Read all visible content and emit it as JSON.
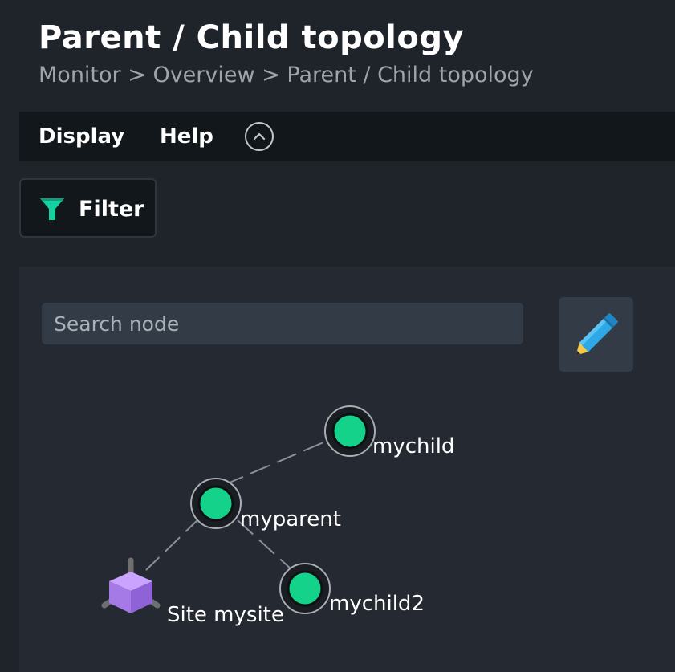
{
  "page": {
    "title": "Parent / Child topology",
    "breadcrumb": [
      "Monitor",
      "Overview",
      "Parent / Child topology"
    ],
    "breadcrumb_separator": ">"
  },
  "menu": {
    "display_label": "Display",
    "help_label": "Help",
    "collapse_icon": "chevron-up-icon"
  },
  "filter": {
    "label": "Filter",
    "icon": "funnel-icon",
    "icon_color": "#15d1a0"
  },
  "search": {
    "placeholder": "Search node",
    "value": ""
  },
  "edit": {
    "icon": "pencil-icon"
  },
  "topology": {
    "nodes": [
      {
        "id": "mychild",
        "label": "mychild",
        "type": "host",
        "status_color": "#15d28a"
      },
      {
        "id": "myparent",
        "label": "myparent",
        "type": "host",
        "status_color": "#15d28a"
      },
      {
        "id": "mychild2",
        "label": "mychild2",
        "type": "host",
        "status_color": "#15d28a"
      },
      {
        "id": "site-mysite",
        "label": "Site mysite",
        "type": "site",
        "icon": "cube-icon",
        "icon_color": "#b083f0"
      }
    ],
    "edges": [
      {
        "from": "myparent",
        "to": "mychild"
      },
      {
        "from": "myparent",
        "to": "mychild2"
      },
      {
        "from": "site-mysite",
        "to": "myparent"
      }
    ]
  },
  "colors": {
    "background": "#1f242b",
    "menubar": "#12171c",
    "panel": "#252a32",
    "input": "#323b46",
    "status_ok": "#15d28a",
    "edge": "#8a8f95"
  }
}
